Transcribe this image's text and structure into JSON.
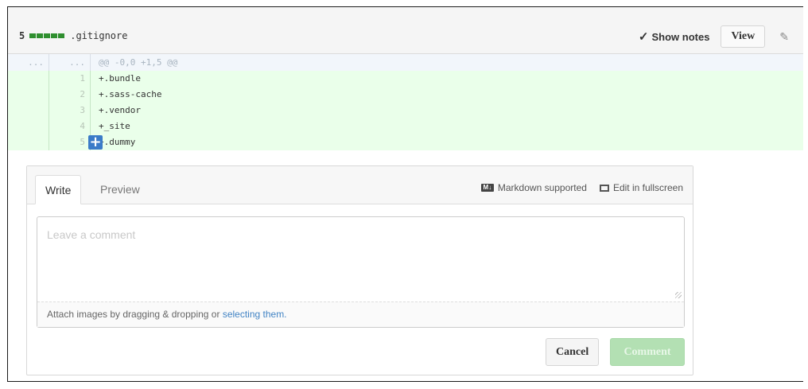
{
  "file_header": {
    "count": "5",
    "filename": ".gitignore",
    "show_notes_label": "Show notes",
    "view_label": "View"
  },
  "diff": {
    "hunk": {
      "old": "...",
      "new": "...",
      "text": "@@ -0,0 +1,5 @@"
    },
    "lines": [
      {
        "num": "1",
        "text": "+.bundle"
      },
      {
        "num": "2",
        "text": "+.sass-cache"
      },
      {
        "num": "3",
        "text": "+.vendor"
      },
      {
        "num": "4",
        "text": "+_site"
      },
      {
        "num": "5",
        "text": "+.dummy"
      }
    ]
  },
  "comment_form": {
    "tabs": [
      {
        "label": "Write"
      },
      {
        "label": "Preview"
      }
    ],
    "markdown_label": "Markdown supported",
    "markdown_icon_text": "M↓",
    "fullscreen_label": "Edit in fullscreen",
    "placeholder": "Leave a comment",
    "attach_text": "Attach images by dragging & dropping or ",
    "attach_link": "selecting them.",
    "cancel_label": "Cancel",
    "comment_label": "Comment"
  },
  "colors": {
    "addition_bg": "#eaffea",
    "hunk_bg": "#f2f6fb",
    "diffstat_green": "#2f8f2f",
    "comment_button_disabled": "#b3e0b3",
    "link": "#4183c4"
  }
}
